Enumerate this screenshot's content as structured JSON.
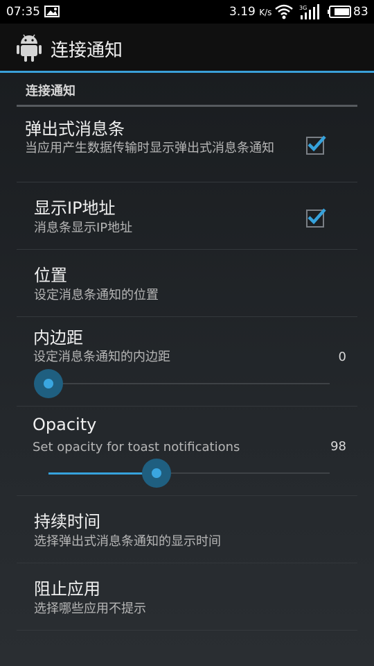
{
  "status_bar": {
    "time": "07:35",
    "speed_value": "3.19",
    "speed_unit": "K/s",
    "battery": "83",
    "icons": [
      "image-notification-icon",
      "wifi-icon",
      "signal-3g-icon",
      "battery-icon"
    ]
  },
  "action_bar": {
    "title": "连接通知",
    "icon": "android-icon"
  },
  "section": {
    "title": "连接通知"
  },
  "prefs": {
    "popup": {
      "title": "弹出式消息条",
      "summary": "当应用产生数据传输时显示弹出式消息条通知",
      "checked": true
    },
    "show_ip": {
      "title": "显示IP地址",
      "summary": "消息条显示IP地址",
      "checked": true
    },
    "position": {
      "title": "位置",
      "summary": "设定消息条通知的位置"
    },
    "padding": {
      "title": "内边距",
      "summary": "设定消息条通知的内边距",
      "value": "0",
      "slider_fraction": 0.0
    },
    "opacity": {
      "title": "Opacity",
      "summary": "Set opacity for toast notifications",
      "value": "98",
      "slider_fraction": 0.44
    },
    "duration": {
      "title": "持续时间",
      "summary": "选择弹出式消息条通知的显示时间"
    },
    "block_apps": {
      "title": "阻止应用",
      "summary": "选择哪些应用不提示"
    }
  },
  "colors": {
    "accent": "#36a2dc",
    "background": "#1a1d20"
  }
}
